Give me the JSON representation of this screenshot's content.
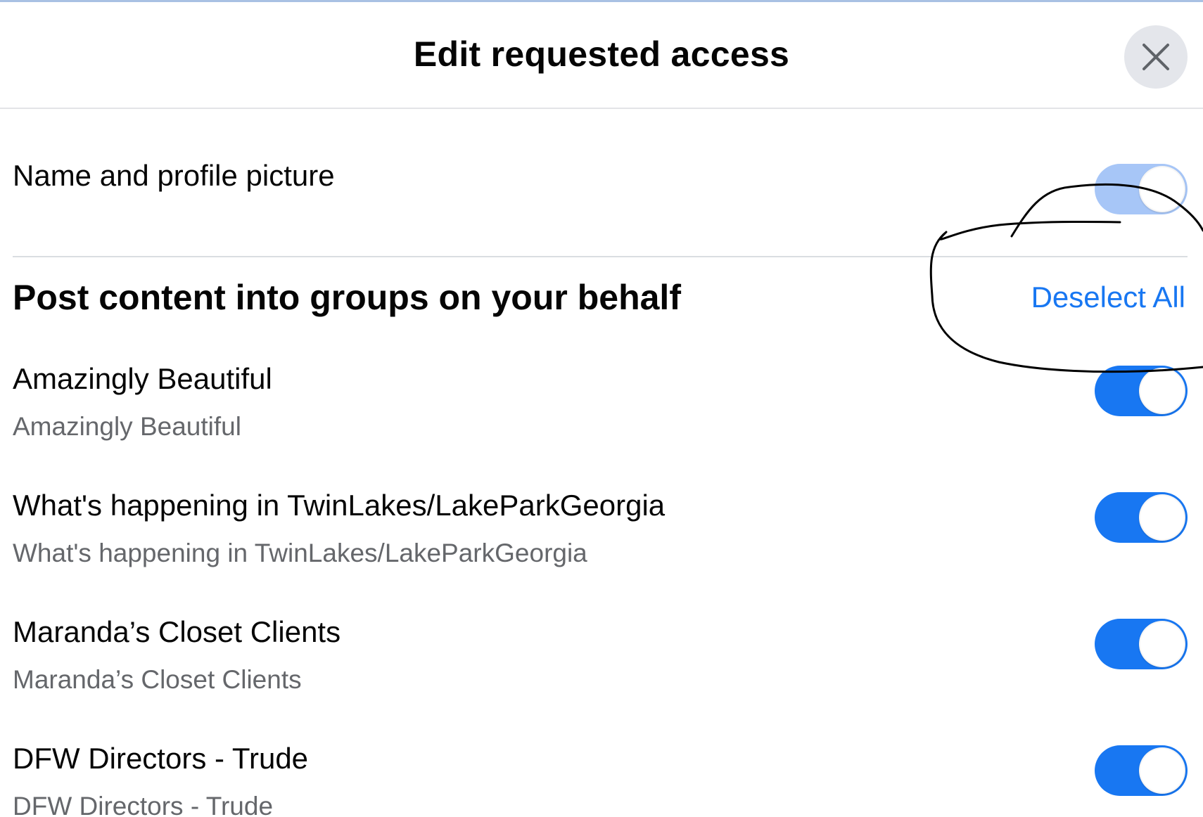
{
  "dialog": {
    "title": "Edit requested access",
    "close_icon": "close-icon"
  },
  "basic_access": {
    "label": "Name and profile picture",
    "enabled": true,
    "locked": true
  },
  "groups_section": {
    "title": "Post content into groups on your behalf",
    "deselect_all_label": "Deselect All",
    "groups": [
      {
        "name": "Amazingly Beautiful",
        "subtitle": "Amazingly Beautiful",
        "enabled": true
      },
      {
        "name": "What's happening in TwinLakes/LakeParkGeorgia",
        "subtitle": "What's happening in TwinLakes/LakeParkGeorgia",
        "enabled": true
      },
      {
        "name": "Maranda’s Closet Clients",
        "subtitle": "Maranda’s Closet Clients",
        "enabled": true
      },
      {
        "name": "DFW Directors - Trude",
        "subtitle": "DFW Directors - Trude",
        "enabled": true
      }
    ]
  },
  "colors": {
    "accent": "#1877f2",
    "toggle_disabled": "#a7c6f7",
    "annotation_ink": "#000000"
  }
}
